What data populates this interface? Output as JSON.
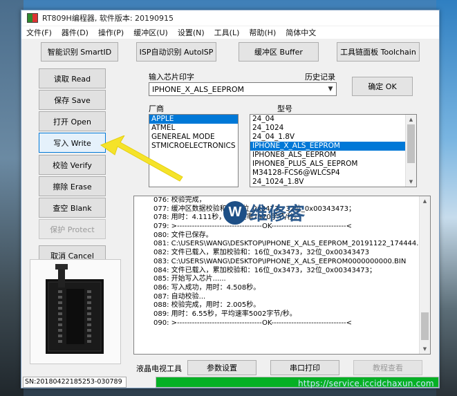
{
  "window": {
    "title": "RT809H编程器, 软件版本: 20190915"
  },
  "menu": [
    "文件(F)",
    "器件(D)",
    "操作(P)",
    "缓冲区(U)",
    "设置(N)",
    "工具(L)",
    "帮助(H)",
    "简体中文"
  ],
  "toolbar": {
    "smartid": "智能识别 SmartID",
    "autoisp": "ISP自动识别 AutoISP",
    "buffer": "缓冲区 Buffer",
    "toolchain": "工具链面板 Toolchain"
  },
  "sidebar": {
    "read": "读取 Read",
    "save": "保存 Save",
    "open": "打开 Open",
    "write": "写入 Write",
    "verify": "校验 Verify",
    "erase": "擦除 Erase",
    "blank": "查空 Blank",
    "protect": "保护 Protect",
    "cancel": "取消 Cancel"
  },
  "chip_input": {
    "label": "输入芯片印字",
    "history_label": "历史记录",
    "value": "IPHONE_X_ALS_EEPROM",
    "ok_button": "确定 OK"
  },
  "vendor": {
    "label": "厂商",
    "items": [
      "APPLE",
      "ATMEL",
      "GENEREAL MODE",
      "STMICROELECTRONICS"
    ],
    "selected": 0
  },
  "model": {
    "label": "型号",
    "items": [
      "24_04",
      "24_1024",
      "24_04_1.8V",
      "IPHONE_X_ALS_EEPROM",
      "IPHONE8_ALS_EEPROM",
      "IPHONE8_PLUS_ALS_EEPROM",
      "M34128-FCS6@WLCSP4",
      "24_1024_1.8V"
    ],
    "selected": 3
  },
  "log": [
    "076: 校验完成，",
    "077: 缓冲区数据校验和：16位_0x3473，32位_0x00343473；",
    "078: 用时：4.111秒，平均速率7970字节/秒。",
    "079: >----------------------------------OK------------------------------<",
    "080: 文件已保存。",
    "081: C:\\USERS\\WANG\\DESKTOP\\IPHONE_X_ALS_EEPROM_20191122_174444.BIN",
    "082: 文件已载入，累加校验和：16位_0x3473，32位_0x00343473",
    "083: C:\\USERS\\WANG\\DESKTOP\\IPHONE_X_ALS_EEPROM0000000000.BIN",
    "084: 文件已载入，累加校验和：16位_0x3473，32位_0x00343473；",
    "085: 开始写入芯片......",
    "086: 写入成功，用时：4.508秒。",
    "087: 自动校验...",
    "088: 校验完成，用时：2.005秒。",
    "089: 用时：6.55秒，平均速率5002字节/秒。",
    "090: >----------------------------------OK------------------------------<"
  ],
  "bottom": {
    "liquid_crystal_tool": "液晶电视工具",
    "param_settings": "参数设置",
    "serial_print": "串口打印",
    "view_tutorial": "教程查看",
    "sn": "SN:20180422185253-030789",
    "progress": 1.0
  },
  "watermark": {
    "logo_letter": "W",
    "logo_text": "维修客",
    "url": "https://service.iccidchaxun.com"
  },
  "colors": {
    "selection": "#0078d7",
    "progress": "#06b025",
    "arrow": "#f5e32a"
  }
}
